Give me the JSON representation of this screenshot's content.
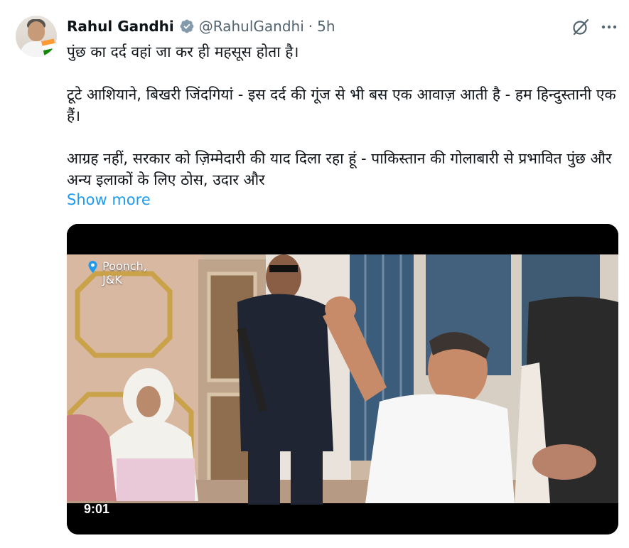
{
  "author": {
    "name": "Rahul Gandhi",
    "handle": "@RahulGandhi",
    "separator": "·",
    "time": "5h",
    "avatar_icon": "profile-photo",
    "verified_icon": "verified-badge-icon"
  },
  "actions": {
    "grok_icon": "grok-icon",
    "more_icon": "more-options-icon"
  },
  "tweet": {
    "paragraphs": [
      "पुंछ का दर्द वहां जा कर ही महसूस होता है।",
      "टूटे आशियाने, बिखरी जिंदगियां - इस दर्द की गूंज से भी बस एक आवाज़ आती है - हम हिन्दुस्तानी एक हैं।",
      "आग्रह नहीं, सरकार को ज़िम्मेदारी की याद दिला रहा हूं - पाकिस्तान की गोलाबारी से प्रभावित पुंछ और अन्य इलाकों के लिए ठोस, उदार और"
    ],
    "show_more": "Show more"
  },
  "media": {
    "type": "video",
    "location_line1": "Poonch,",
    "location_line2": "J&K",
    "location_icon": "location-pin-icon",
    "duration": "9:01"
  },
  "colors": {
    "text": "#0f1419",
    "secondary": "#536471",
    "link": "#1d9bf0",
    "verified": "#829aab"
  }
}
